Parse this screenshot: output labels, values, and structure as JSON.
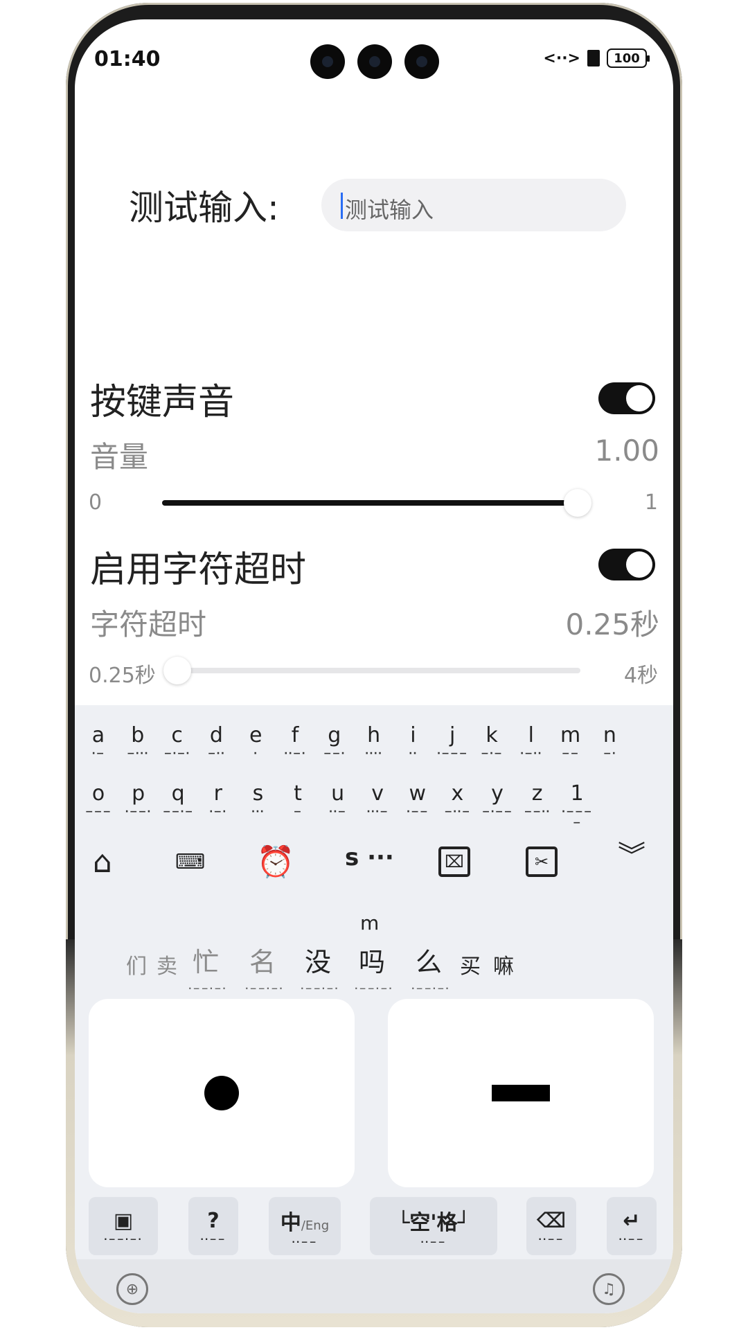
{
  "status_bar": {
    "time": "01:40",
    "battery": "100",
    "data_icon": "<··>"
  },
  "test_input": {
    "label": "测试输入:",
    "placeholder": "测试输入"
  },
  "key_sound": {
    "title": "按键声音",
    "enabled": true,
    "volume_label": "音量",
    "volume_value": "1.00",
    "slider_min": "0",
    "slider_max": "1",
    "slider_level": 1.0
  },
  "char_timeout": {
    "title": "启用字符超时",
    "enabled": true,
    "timeout_label": "字符超时",
    "timeout_value": "0.25秒",
    "slider_min": "0.25秒",
    "slider_max": "4秒",
    "slider_level": 0.0
  },
  "keyboard": {
    "morse_row1": [
      {
        "letter": "a",
        "code": "·−"
      },
      {
        "letter": "b",
        "code": "−···"
      },
      {
        "letter": "c",
        "code": "−·−·"
      },
      {
        "letter": "d",
        "code": "−··"
      },
      {
        "letter": "e",
        "code": "·"
      },
      {
        "letter": "f",
        "code": "··−·"
      },
      {
        "letter": "g",
        "code": "−−·"
      },
      {
        "letter": "h",
        "code": "····"
      },
      {
        "letter": "i",
        "code": "··"
      },
      {
        "letter": "j",
        "code": "·−−−"
      },
      {
        "letter": "k",
        "code": "−·−"
      },
      {
        "letter": "l",
        "code": "·−··"
      },
      {
        "letter": "m",
        "code": "−−"
      },
      {
        "letter": "n",
        "code": "−·"
      }
    ],
    "morse_row2": [
      {
        "letter": "o",
        "code": "−−−"
      },
      {
        "letter": "p",
        "code": "·−−·"
      },
      {
        "letter": "q",
        "code": "−−·−"
      },
      {
        "letter": "r",
        "code": "·−·"
      },
      {
        "letter": "s",
        "code": "···"
      },
      {
        "letter": "t",
        "code": "−"
      },
      {
        "letter": "u",
        "code": "··−"
      },
      {
        "letter": "v",
        "code": "···−"
      },
      {
        "letter": "w",
        "code": "·−−"
      },
      {
        "letter": "x",
        "code": "−··−"
      },
      {
        "letter": "y",
        "code": "−·−−"
      },
      {
        "letter": "z",
        "code": "−−··"
      },
      {
        "letter": "1",
        "code": "·−−−−"
      }
    ],
    "compose_text": "s ···",
    "compose_pinyin": "m",
    "candidates": [
      "们",
      "卖",
      "忙",
      "名",
      "没",
      "吗",
      "么",
      "买",
      "嘛"
    ],
    "dot_key": "·",
    "dash_key": "−",
    "fn_keys": {
      "chinese_eng_main": "中",
      "chinese_eng_sub": "/Eng",
      "space_label": "└空'格┘",
      "code_short": "··−−",
      "code_long": "·−−·−·"
    },
    "tool_icons": [
      "home-settings-icon",
      "keyboard-icon",
      "alarm-off-icon",
      "clipboard-icon",
      "scissors-icon",
      "collapse-icon"
    ]
  }
}
